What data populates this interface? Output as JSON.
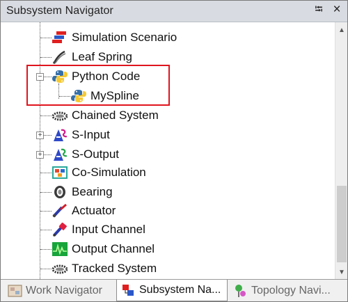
{
  "panel": {
    "title": "Subsystem Navigator",
    "pin_glyph": "⭾",
    "close_glyph": "×"
  },
  "tree": {
    "items": [
      {
        "label": "Simulation Scenario",
        "icon": "simulation-scenario-icon"
      },
      {
        "label": "Leaf Spring",
        "icon": "leaf-spring-icon"
      },
      {
        "label": "Python Code",
        "icon": "python-icon",
        "expanded": true
      },
      {
        "label": "MySpline",
        "icon": "python-icon",
        "child": true
      },
      {
        "label": "Chained System",
        "icon": "chained-system-icon"
      },
      {
        "label": "S-Input",
        "icon": "s-input-icon",
        "collapsed": true
      },
      {
        "label": "S-Output",
        "icon": "s-output-icon",
        "collapsed": true
      },
      {
        "label": "Co-Simulation",
        "icon": "co-simulation-icon"
      },
      {
        "label": "Bearing",
        "icon": "bearing-icon"
      },
      {
        "label": "Actuator",
        "icon": "actuator-icon"
      },
      {
        "label": "Input Channel",
        "icon": "input-channel-icon"
      },
      {
        "label": "Output Channel",
        "icon": "output-channel-icon"
      },
      {
        "label": "Tracked System",
        "icon": "tracked-system-icon"
      }
    ],
    "expander_minus": "−",
    "expander_plus": "+"
  },
  "scrollbar": {
    "up_glyph": "▲",
    "down_glyph": "▼"
  },
  "tabs": [
    {
      "label": "Work Navigator",
      "icon": "work-navigator-icon",
      "active": false
    },
    {
      "label": "Subsystem Na...",
      "icon": "subsystem-navigator-icon",
      "active": true
    },
    {
      "label": "Topology Navi...",
      "icon": "topology-navigator-icon",
      "active": false
    }
  ],
  "colors": {
    "highlight_border": "#e0141e",
    "python_blue": "#3670a8",
    "python_yellow": "#f5c935"
  }
}
